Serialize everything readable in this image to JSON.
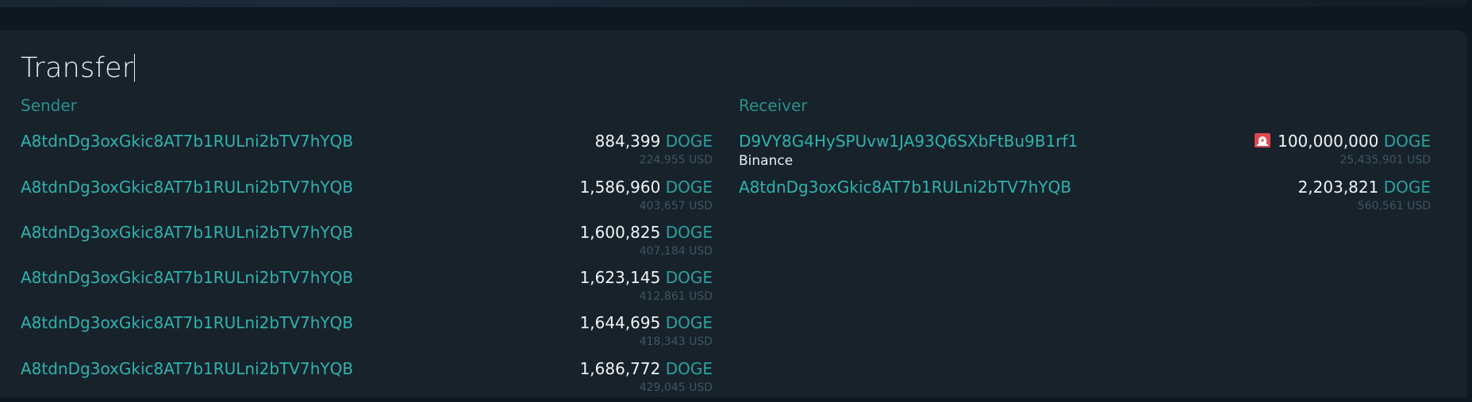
{
  "title": "Transfer",
  "sender": {
    "heading": "Sender",
    "rows": [
      {
        "address": "A8tdnDg3oxGkic8AT7b1RULni2bTV7hYQB",
        "amount": "884,399",
        "currency": "DOGE",
        "usd": "224,955 USD"
      },
      {
        "address": "A8tdnDg3oxGkic8AT7b1RULni2bTV7hYQB",
        "amount": "1,586,960",
        "currency": "DOGE",
        "usd": "403,657 USD"
      },
      {
        "address": "A8tdnDg3oxGkic8AT7b1RULni2bTV7hYQB",
        "amount": "1,600,825",
        "currency": "DOGE",
        "usd": "407,184 USD"
      },
      {
        "address": "A8tdnDg3oxGkic8AT7b1RULni2bTV7hYQB",
        "amount": "1,623,145",
        "currency": "DOGE",
        "usd": "412,861 USD"
      },
      {
        "address": "A8tdnDg3oxGkic8AT7b1RULni2bTV7hYQB",
        "amount": "1,644,695",
        "currency": "DOGE",
        "usd": "418,343 USD"
      },
      {
        "address": "A8tdnDg3oxGkic8AT7b1RULni2bTV7hYQB",
        "amount": "1,686,772",
        "currency": "DOGE",
        "usd": "429,045 USD"
      }
    ]
  },
  "receiver": {
    "heading": "Receiver",
    "rows": [
      {
        "address": "D9VY8G4HySPUvw1JA93Q6SXbFtBu9B1rf1",
        "label": "Binance",
        "alert_icon": "siren-icon",
        "amount": "100,000,000",
        "currency": "DOGE",
        "usd": "25,435,901 USD"
      },
      {
        "address": "A8tdnDg3oxGkic8AT7b1RULni2bTV7hYQB",
        "amount": "2,203,821",
        "currency": "DOGE",
        "usd": "560,561 USD"
      }
    ]
  },
  "colors": {
    "background": "#0f1820",
    "panel": "#17222b",
    "accent": "#2fb3ad",
    "heading": "#2a8f8a",
    "muted": "#3d5563",
    "alert": "#e0474c"
  }
}
